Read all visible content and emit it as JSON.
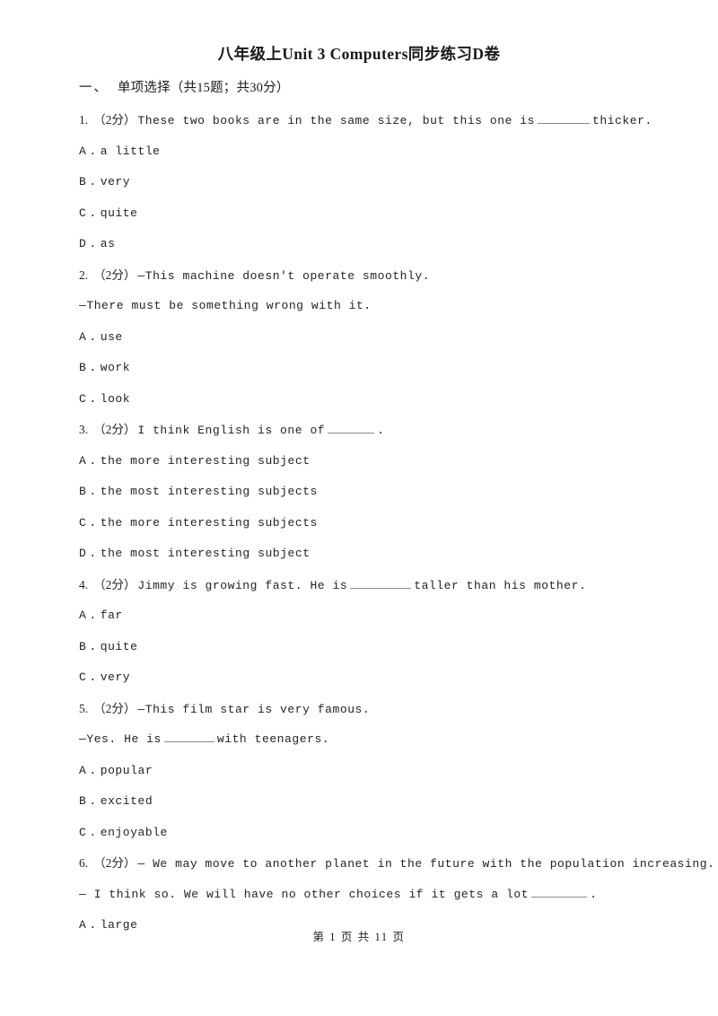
{
  "document": {
    "title": "八年级上Unit 3 Computers同步练习D卷",
    "footer": "第 1 页 共 11 页"
  },
  "section": {
    "number": "一、",
    "label": "单项选择（共15题；共30分）"
  },
  "questions": [
    {
      "number": "1.",
      "score": "（2分）",
      "lines": [
        {
          "before": "These two books are in the same size, but this one is",
          "blank": "w1",
          "after": "thicker."
        }
      ],
      "options": [
        {
          "letter": "A",
          "dot": ".",
          "text": "a little"
        },
        {
          "letter": "B",
          "dot": ".",
          "text": "very"
        },
        {
          "letter": "C",
          "dot": ".",
          "text": "quite"
        },
        {
          "letter": "D",
          "dot": ".",
          "text": "as"
        }
      ]
    },
    {
      "number": "2.",
      "score": "（2分）",
      "lines": [
        {
          "before": "—This machine doesn't operate smoothly.",
          "blank": "",
          "after": ""
        },
        {
          "before": "—There must be something wrong with it.",
          "blank": "",
          "after": "",
          "continuation": true
        }
      ],
      "options": [
        {
          "letter": "A",
          "dot": ".",
          "text": "use"
        },
        {
          "letter": "B",
          "dot": ".",
          "text": "work"
        },
        {
          "letter": "C",
          "dot": ".",
          "text": "look"
        }
      ]
    },
    {
      "number": "3.",
      "score": "（2分）",
      "lines": [
        {
          "before": "I think English is one of",
          "blank": "w2",
          "after": "."
        }
      ],
      "options": [
        {
          "letter": "A",
          "dot": ".",
          "text": "the more interesting subject"
        },
        {
          "letter": "B",
          "dot": ".",
          "text": "the most interesting subjects"
        },
        {
          "letter": "C",
          "dot": ".",
          "text": "the more interesting subjects"
        },
        {
          "letter": "D",
          "dot": ".",
          "text": "the most interesting subject"
        }
      ]
    },
    {
      "number": "4.",
      "score": "（2分）",
      "lines": [
        {
          "before": "Jimmy is growing fast. He is",
          "blank": "w3",
          "after": "taller than his mother."
        }
      ],
      "options": [
        {
          "letter": "A",
          "dot": ".",
          "text": "far"
        },
        {
          "letter": "B",
          "dot": ".",
          "text": "quite"
        },
        {
          "letter": "C",
          "dot": ".",
          "text": "very"
        }
      ]
    },
    {
      "number": "5.",
      "score": "（2分）",
      "lines": [
        {
          "before": "—This film star is very famous.",
          "blank": "",
          "after": ""
        },
        {
          "before": "—Yes. He is",
          "blank": "w4",
          "after": "with teenagers.",
          "continuation": true
        }
      ],
      "options": [
        {
          "letter": "A",
          "dot": ".",
          "text": "popular"
        },
        {
          "letter": "B",
          "dot": ".",
          "text": "excited"
        },
        {
          "letter": "C",
          "dot": ".",
          "text": "enjoyable"
        }
      ]
    },
    {
      "number": "6.",
      "score": "（2分）",
      "lines": [
        {
          "before": "— We may move to another planet in the future with the population increasing.",
          "blank": "",
          "after": ""
        },
        {
          "before": "— I think so. We will have no other choices if it gets a lot",
          "blank": "w5",
          "after": ".",
          "continuation": true
        }
      ],
      "options": [
        {
          "letter": "A",
          "dot": ".",
          "text": "large"
        }
      ]
    }
  ]
}
